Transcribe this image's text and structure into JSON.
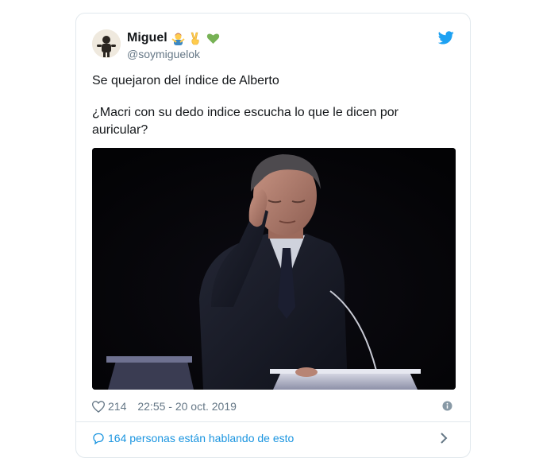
{
  "user": {
    "display_name": "Miguel",
    "handle": "@soymiguelok",
    "name_emojis": [
      "person-gesturing-no-emoji",
      "victory-hand-emoji",
      "green-heart-emoji"
    ]
  },
  "tweet": {
    "line1": "Se quejaron del índice de Alberto",
    "line2": "¿Macri con su dedo indice escucha lo que le dicen por auricular?"
  },
  "meta": {
    "like_count": "214",
    "timestamp": "22:55 - 20 oct. 2019"
  },
  "footer": {
    "conversation_text": "164 personas están hablando de esto"
  },
  "colors": {
    "link_blue": "#1b95e0",
    "twitter_blue": "#1da1f2",
    "secondary_text": "#657786",
    "border": "#e1e8ed"
  },
  "icons": {
    "brand": "twitter-bird-icon",
    "like": "heart-outline-icon",
    "info": "info-icon",
    "conversation": "speech-bubble-icon",
    "chevron": "chevron-right-icon"
  }
}
